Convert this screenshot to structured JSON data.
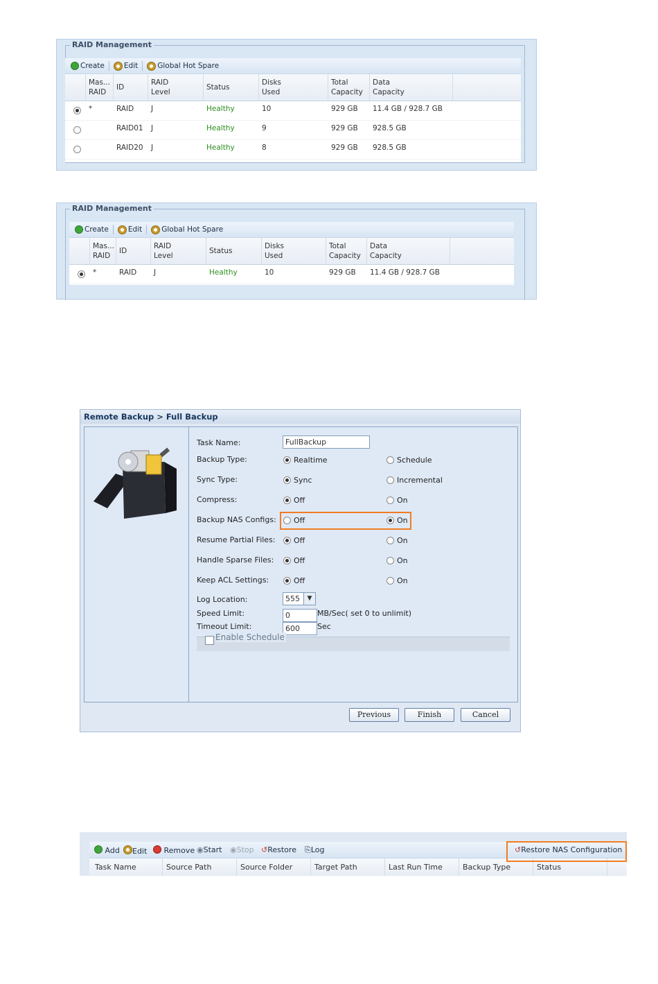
{
  "raid1": {
    "title": "RAID Management",
    "toolbar": {
      "create": "Create",
      "edit": "Edit",
      "global_hot_spare": "Global Hot Spare"
    },
    "columns": [
      "Mas... RAID",
      "ID",
      "RAID Level",
      "Status",
      "Disks Used",
      "Total Capacity",
      "Data Capacity"
    ],
    "col_lines": [
      [
        "Mas...",
        "RAID"
      ],
      [
        "ID"
      ],
      [
        "RAID",
        "Level"
      ],
      [
        "Status"
      ],
      [
        "Disks",
        "Used"
      ],
      [
        "Total",
        "Capacity"
      ],
      [
        "Data",
        "Capacity"
      ]
    ],
    "rows": [
      {
        "selected": true,
        "master": "*",
        "id": "RAID",
        "level": "J",
        "status": "Healthy",
        "disks": "10",
        "total": "929 GB",
        "data": "11.4 GB / 928.7 GB"
      },
      {
        "selected": false,
        "master": "",
        "id": "RAID01",
        "level": "J",
        "status": "Healthy",
        "disks": "9",
        "total": "929 GB",
        "data": "928.5 GB"
      },
      {
        "selected": false,
        "master": "",
        "id": "RAID20",
        "level": "J",
        "status": "Healthy",
        "disks": "8",
        "total": "929 GB",
        "data": "928.5 GB"
      }
    ]
  },
  "raid2": {
    "title": "RAID Management",
    "toolbar": {
      "create": "Create",
      "edit": "Edit",
      "global_hot_spare": "Global Hot Spare"
    },
    "col_lines": [
      [
        "Mas...",
        "RAID"
      ],
      [
        "ID"
      ],
      [
        "RAID",
        "Level"
      ],
      [
        "Status"
      ],
      [
        "Disks",
        "Used"
      ],
      [
        "Total",
        "Capacity"
      ],
      [
        "Data",
        "Capacity"
      ]
    ],
    "rows": [
      {
        "selected": true,
        "master": "*",
        "id": "RAID",
        "level": "J",
        "status": "Healthy",
        "disks": "10",
        "total": "929 GB",
        "data": "11.4 GB / 928.7 GB"
      }
    ]
  },
  "remote_backup": {
    "title": "Remote Backup > Full Backup",
    "task_name_label": "Task Name:",
    "task_name_value": "FullBackup",
    "rows": [
      {
        "label": "Backup Type:",
        "opt1": "Realtime",
        "opt2": "Schedule",
        "selected": 1
      },
      {
        "label": "Sync Type:",
        "opt1": "Sync",
        "opt2": "Incremental",
        "selected": 1
      },
      {
        "label": "Compress:",
        "opt1": "Off",
        "opt2": "On",
        "selected": 1
      },
      {
        "label": "Backup NAS Configs:",
        "opt1": "Off",
        "opt2": "On",
        "selected": 2,
        "highlight": true
      },
      {
        "label": "Resume Partial Files:",
        "opt1": "Off",
        "opt2": "On",
        "selected": 1
      },
      {
        "label": "Handle Sparse Files:",
        "opt1": "Off",
        "opt2": "On",
        "selected": 1
      },
      {
        "label": "Keep ACL Settings:",
        "opt1": "Off",
        "opt2": "On",
        "selected": 1
      }
    ],
    "log_location_label": "Log Location:",
    "log_location_value": "555",
    "speed_limit_label": "Speed Limit:",
    "speed_limit_value": "0",
    "speed_limit_unit": "MB/Sec( set 0 to unlimit)",
    "timeout_limit_label": "Timeout Limit:",
    "timeout_limit_value": "600",
    "timeout_limit_unit": "Sec",
    "enable_schedule_label": "Enable Schedule",
    "buttons": {
      "previous": "Previous",
      "finish": "Finish",
      "cancel": "Cancel"
    },
    "highlight_color": "#f27c21"
  },
  "backup_list": {
    "toolbar": {
      "add": "Add",
      "edit": "Edit",
      "remove": "Remove",
      "start": "Start",
      "stop": "Stop",
      "restore": "Restore",
      "log": "Log",
      "restore_nas": "Restore NAS Configuration"
    },
    "columns": [
      "Task Name",
      "Source Path",
      "Source Folder",
      "Target Path",
      "Last Run Time",
      "Backup Type",
      "Status"
    ]
  }
}
